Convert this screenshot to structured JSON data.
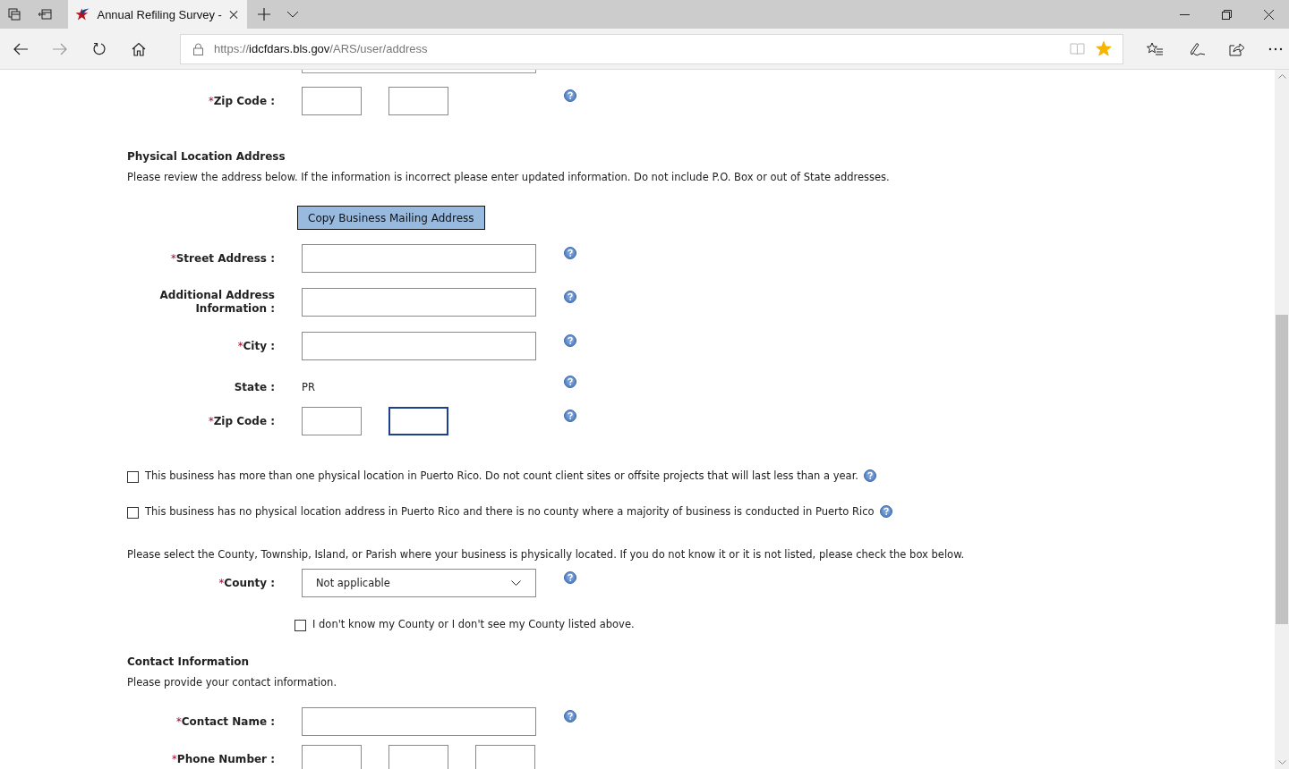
{
  "browser": {
    "tab": {
      "title": "Annual Refiling Survey -"
    },
    "address": {
      "scheme": "https://",
      "host": "idcfdars.bls.gov",
      "path": "/ARS/user/address"
    },
    "favorite": true
  },
  "form": [
    {
      "kind": "multi",
      "required_mark": "*",
      "label": "Zip Code :",
      "help": true,
      "inputs": [
        {
          "focused": false
        },
        {
          "focused": false
        }
      ]
    },
    {
      "kind": "heading",
      "text": "Physical Location Address"
    },
    {
      "kind": "note",
      "text": "Please review the address below. If the information is incorrect please enter updated information. Do not include P.O. Box or out of State addresses."
    },
    {
      "kind": "button",
      "label": "Copy Business Mailing Address"
    },
    {
      "kind": "text",
      "required_mark": "*",
      "label": "Street Address :",
      "help": true,
      "focused": false
    },
    {
      "kind": "text",
      "label": "Additional Address Information :",
      "help": true,
      "focused": false
    },
    {
      "kind": "text",
      "required_mark": "*",
      "label": "City :",
      "help": true,
      "focused": false
    },
    {
      "kind": "static",
      "label": "State :",
      "value": "PR",
      "help": true
    },
    {
      "kind": "multi",
      "required_mark": "*",
      "label": "Zip Code :",
      "help": true,
      "inputs": [
        {
          "focused": false
        },
        {
          "focused": true
        }
      ]
    },
    {
      "kind": "checkbox",
      "text": "This business has more than one physical location in Puerto Rico. Do not count client sites or offsite projects that will last less than a year.",
      "checked": false,
      "help": true
    },
    {
      "kind": "checkbox",
      "text": "This business has no physical location address in Puerto Rico and there is no county where a majority of business is conducted in Puerto Rico",
      "checked": false,
      "help": true
    },
    {
      "kind": "note",
      "text": "Please select the County, Township, Island, or Parish where your business is physically located. If you do not know it or it is not listed, please check the box below."
    },
    {
      "kind": "select",
      "required_mark": "*",
      "label": "County :",
      "value": "Not applicable",
      "help": true
    },
    {
      "kind": "subcheck",
      "text": "I don't know my County or I don't see my County listed above.",
      "checked": false
    },
    {
      "kind": "heading",
      "text": "Contact Information"
    },
    {
      "kind": "note",
      "text": "Please provide your contact information."
    },
    {
      "kind": "text",
      "required_mark": "*",
      "label": "Contact Name :",
      "help": true,
      "focused": false
    },
    {
      "kind": "multi",
      "required_mark": "*",
      "label": "Phone Number :",
      "help": false,
      "inputs": [
        {
          "focused": false
        },
        {
          "focused": false
        },
        {
          "focused": false
        }
      ]
    }
  ]
}
